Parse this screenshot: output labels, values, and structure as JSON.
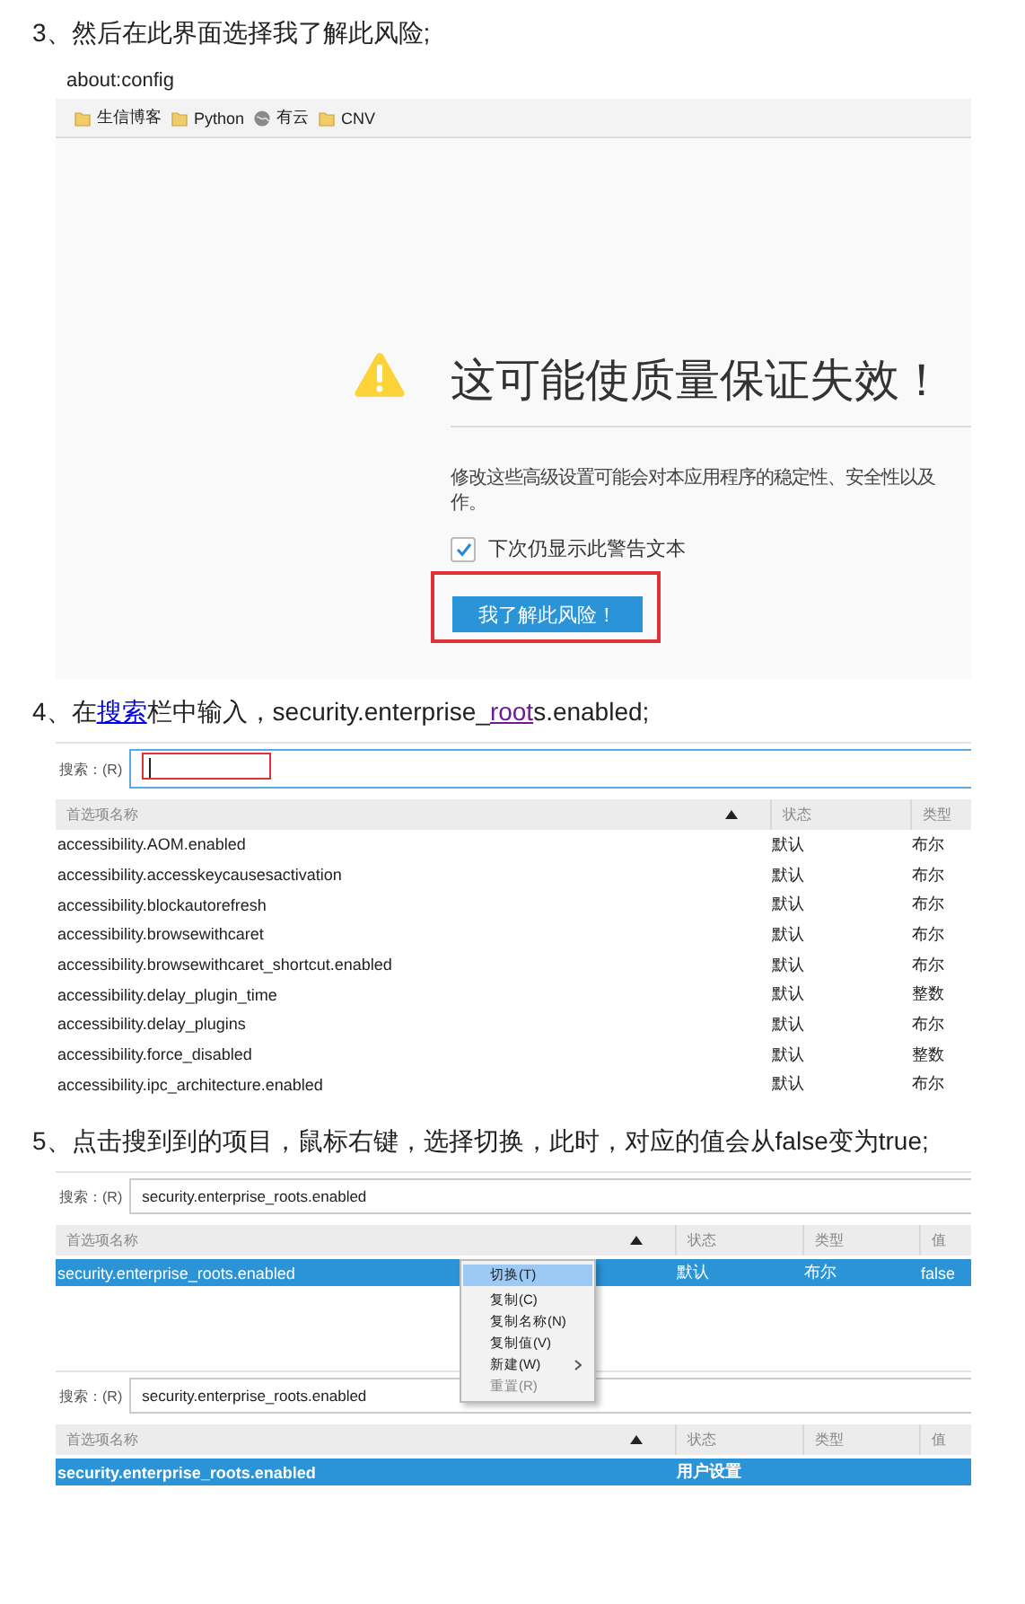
{
  "steps": [
    {
      "heading": [
        {
          "text": "3、然后在此界面选择我了解此风险;"
        }
      ],
      "shots": [
        {
          "kind": "warning",
          "address": "about:config",
          "bookmarks": [
            {
              "label": "生信博客",
              "kind": "folder"
            },
            {
              "label": "Python",
              "kind": "folder"
            },
            {
              "label": "有云",
              "kind": "globe"
            },
            {
              "label": "CNV",
              "kind": "folder"
            }
          ],
          "title": "这可能使质量保证失效！",
          "body_lines": [
            "修改这些高级设置可能会对本应用程序的稳定性、安全性以及",
            "作。"
          ],
          "checkbox": {
            "label": "下次仍显示此警告文本",
            "checked": true
          },
          "button": {
            "label": "我了解此风险！",
            "highlighted": true
          }
        }
      ]
    },
    {
      "heading": [
        {
          "text": "4、在"
        },
        {
          "text": "搜索",
          "link": true,
          "visited": false
        },
        {
          "text": "栏中输入，security.enterprise_"
        },
        {
          "text": "root",
          "link": true,
          "visited": true
        },
        {
          "text": "s.enabled;"
        }
      ],
      "shots": [
        {
          "kind": "config",
          "search_label": "搜索：(R)",
          "focused": true,
          "highlighted": true,
          "columns": [
            {
              "label": "首选项名称",
              "sorted": true
            },
            {
              "label": "状态",
              "sorted": false
            },
            {
              "label": "类型",
              "sorted": false
            }
          ],
          "rows": [
            {
              "cells": [
                "accessibility.AOM.enabled",
                "默认",
                "布尔"
              ],
              "selected": false,
              "bold": false
            },
            {
              "cells": [
                "accessibility.accesskeycausesactivation",
                "默认",
                "布尔"
              ],
              "selected": false,
              "bold": false
            },
            {
              "cells": [
                "accessibility.blockautorefresh",
                "默认",
                "布尔"
              ],
              "selected": false,
              "bold": false
            },
            {
              "cells": [
                "accessibility.browsewithcaret",
                "默认",
                "布尔"
              ],
              "selected": false,
              "bold": false
            },
            {
              "cells": [
                "accessibility.browsewithcaret_shortcut.enabled",
                "默认",
                "布尔"
              ],
              "selected": false,
              "bold": false
            },
            {
              "cells": [
                "accessibility.delay_plugin_time",
                "默认",
                "整数"
              ],
              "selected": false,
              "bold": false
            },
            {
              "cells": [
                "accessibility.delay_plugins",
                "默认",
                "布尔"
              ],
              "selected": false,
              "bold": false
            },
            {
              "cells": [
                "accessibility.force_disabled",
                "默认",
                "整数"
              ],
              "selected": false,
              "bold": false
            },
            {
              "cells": [
                "accessibility.ipc_architecture.enabled",
                "默认",
                "布尔"
              ],
              "selected": false,
              "bold": false
            }
          ]
        }
      ]
    },
    {
      "heading": [
        {
          "text": "5、点击搜到到的项目，鼠标右键，选择切换，此时，对应的值会从false变为true;"
        }
      ],
      "shots": [
        {
          "kind": "config",
          "search_label": "搜索：(R)",
          "search_value": "security.enterprise_roots.enabled",
          "focused": false,
          "columns": [
            {
              "label": "首选项名称",
              "sorted": true
            },
            {
              "label": "状态",
              "sorted": false
            },
            {
              "label": "类型",
              "sorted": false
            },
            {
              "label": "值",
              "sorted": false
            }
          ],
          "rows": [
            {
              "cells": [
                "security.enterprise_roots.enabled",
                "默认",
                "布尔",
                "false"
              ],
              "selected": true,
              "bold": false
            }
          ],
          "menu": [
            {
              "label": "切换(T)",
              "selected": true,
              "disabled": false,
              "submenu": false
            },
            {
              "label": "复制(C)",
              "selected": false,
              "disabled": false,
              "submenu": false
            },
            {
              "label": "复制名称(N)",
              "selected": false,
              "disabled": false,
              "submenu": false
            },
            {
              "label": "复制值(V)",
              "selected": false,
              "disabled": false,
              "submenu": false
            },
            {
              "label": "新建(W)",
              "selected": false,
              "disabled": false,
              "submenu": true
            },
            {
              "label": "重置(R)",
              "selected": false,
              "disabled": true,
              "submenu": false
            }
          ]
        },
        {
          "kind": "config",
          "search_label": "搜索：(R)",
          "search_value": "security.enterprise_roots.enabled",
          "focused": false,
          "columns": [
            {
              "label": "首选项名称",
              "sorted": true
            },
            {
              "label": "状态",
              "sorted": false
            },
            {
              "label": "类型",
              "sorted": false
            },
            {
              "label": "值",
              "sorted": false
            }
          ],
          "rows": [
            {
              "cells": [
                "security.enterprise_roots.enabled",
                "用户设置"
              ],
              "selected": true,
              "bold": true
            }
          ]
        }
      ]
    }
  ]
}
